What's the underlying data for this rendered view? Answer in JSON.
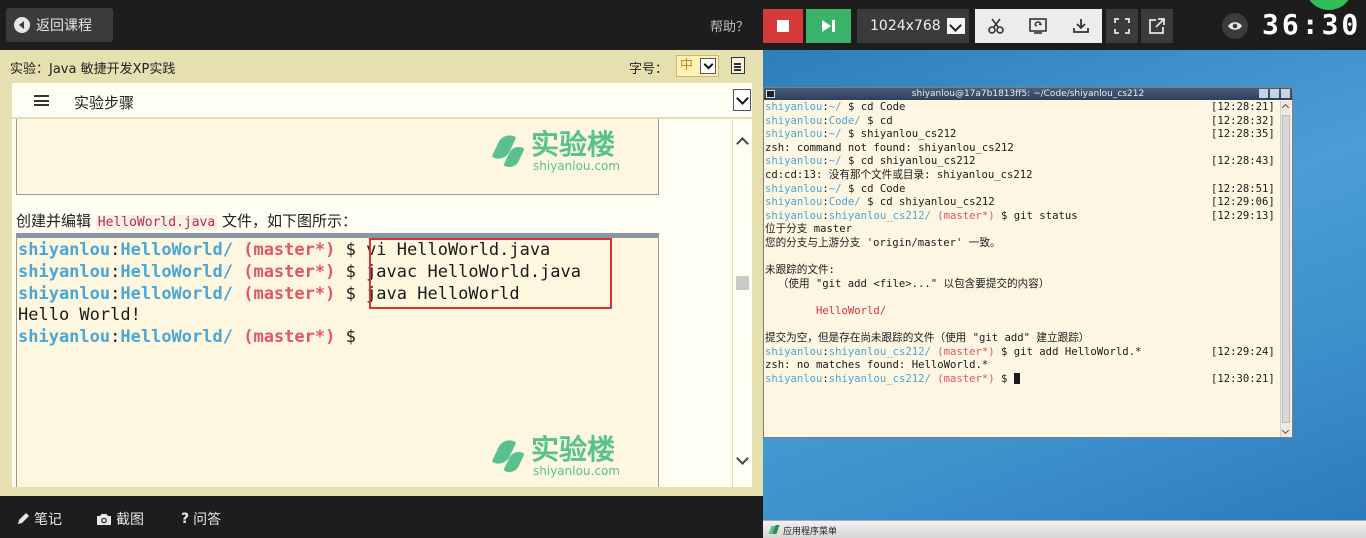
{
  "topbar": {
    "back_label": "返回课程",
    "help_label": "帮助？",
    "resolution": "1024x768",
    "timer": "36:30"
  },
  "left": {
    "title": "实验：Java 敏捷开发XP实践",
    "font_size_label": "字号：",
    "font_size_value": "中",
    "steps_label": "实验步骤"
  },
  "content": {
    "logo_cn": "实验楼",
    "logo_en": "shiyanlou.com",
    "caption_before": "创建并编辑",
    "caption_code": "HelloWorld.java",
    "caption_after": "文件，如下图所示：",
    "big_terminal": {
      "user": "shiyanlou",
      "path": "HelloWorld/",
      "branch": "(master*)",
      "cmd1": "vi HelloWorld.java",
      "cmd2": "javac HelloWorld.java",
      "cmd3": "java HelloWorld",
      "output": "Hello World!"
    }
  },
  "bottombar": {
    "notes": "笔记",
    "screenshot": "截图",
    "qa": "问答"
  },
  "terminal": {
    "title": "shiyanlou@17a7b1813ff5: ~/Code/shiyanlou_cs212",
    "lines": [
      {
        "t": "prompt",
        "path": "~/",
        "branch": "",
        "cmd": "cd Code",
        "ts": "[12:28:21]"
      },
      {
        "t": "prompt",
        "path": "Code/",
        "branch": "",
        "cmd": "cd",
        "ts": "[12:28:32]"
      },
      {
        "t": "prompt",
        "path": "~/",
        "branch": "",
        "cmd": "shiyanlou_cs212",
        "ts": "[12:28:35]"
      },
      {
        "t": "text",
        "text": "zsh: command not found: shiyanlou_cs212"
      },
      {
        "t": "prompt",
        "path": "~/",
        "branch": "",
        "cmd": "cd shiyanlou_cs212",
        "ts": "[12:28:43]"
      },
      {
        "t": "text",
        "text": "cd:cd:13: 没有那个文件或目录: shiyanlou_cs212"
      },
      {
        "t": "prompt",
        "path": "~/",
        "branch": "",
        "cmd": "cd Code",
        "ts": "[12:28:51]"
      },
      {
        "t": "prompt",
        "path": "Code/",
        "branch": "",
        "cmd": "cd shiyanlou_cs212",
        "ts": "[12:29:06]"
      },
      {
        "t": "prompt",
        "path": "shiyanlou_cs212/",
        "branch": "(master*)",
        "cmd": "git status",
        "ts": "[12:29:13]"
      },
      {
        "t": "text",
        "text": "位于分支 master"
      },
      {
        "t": "text",
        "text": "您的分支与上游分支 'origin/master' 一致。"
      },
      {
        "t": "text",
        "text": ""
      },
      {
        "t": "text",
        "text": "未跟踪的文件:"
      },
      {
        "t": "text",
        "text": "  （使用 \"git add <file>...\" 以包含要提交的内容）"
      },
      {
        "t": "text",
        "text": ""
      },
      {
        "t": "red",
        "text": "        HelloWorld/"
      },
      {
        "t": "text",
        "text": ""
      },
      {
        "t": "text",
        "text": "提交为空，但是存在尚未跟踪的文件（使用 \"git add\" 建立跟踪）"
      },
      {
        "t": "prompt",
        "path": "shiyanlou_cs212/",
        "branch": "(master*)",
        "cmd": "git add HelloWorld.*",
        "ts": "[12:29:24]"
      },
      {
        "t": "text",
        "text": "zsh: no matches found: HelloWorld.*"
      },
      {
        "t": "prompt",
        "path": "shiyanlou_cs212/",
        "branch": "(master*)",
        "cmd": "",
        "ts": "[12:30:21]",
        "cursor": true
      }
    ],
    "user": "shiyanlou"
  },
  "taskbar": {
    "menu_label": "应用程序菜单"
  },
  "colors": {
    "stop": "#d43a3a",
    "play": "#3ab26a",
    "prompt_blue": "#4aa6d6",
    "branch_red": "#e05664",
    "logo_green": "#59c18d"
  }
}
